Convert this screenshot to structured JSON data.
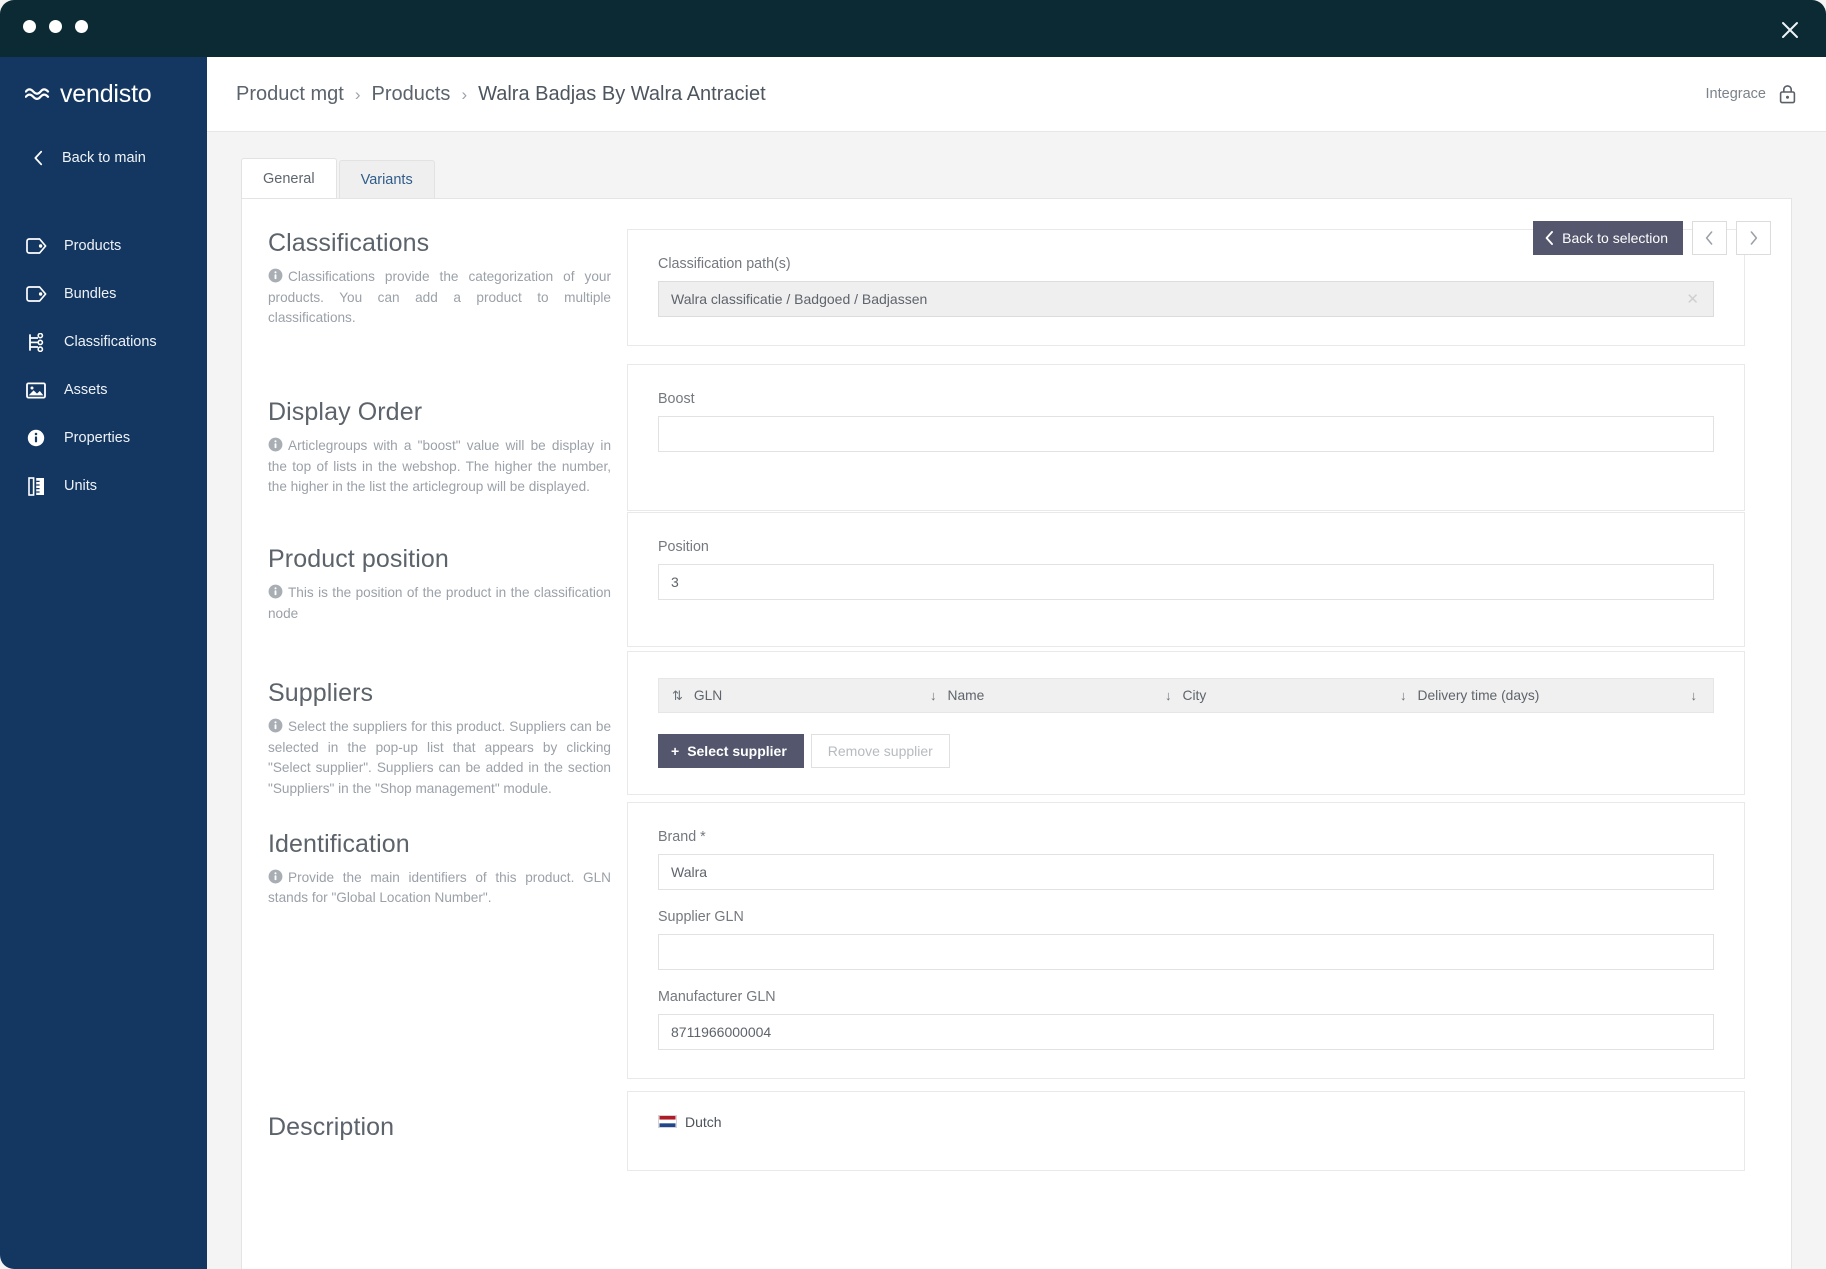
{
  "window": {
    "close_icon": "close-icon",
    "traffic_lights": 3
  },
  "sidebar": {
    "brand": "vendisto",
    "brand_icon": "waves-logo-icon",
    "back_label": "Back to main",
    "back_icon": "chevron-left-icon",
    "items": [
      {
        "label": "Products",
        "icon": "tag-icon"
      },
      {
        "label": "Bundles",
        "icon": "tag-icon"
      },
      {
        "label": "Classifications",
        "icon": "sitemap-icon"
      },
      {
        "label": "Assets",
        "icon": "image-icon"
      },
      {
        "label": "Properties",
        "icon": "info-circle-icon"
      },
      {
        "label": "Units",
        "icon": "ruler-icon"
      }
    ]
  },
  "topbar": {
    "breadcrumb": [
      "Product mgt",
      "Products",
      "Walra Badjas By Walra Antraciet"
    ],
    "separator": "›",
    "account_label": "Integrace",
    "lock_icon": "lock-icon"
  },
  "tabs": [
    {
      "label": "General",
      "active": true
    },
    {
      "label": "Variants",
      "active": false
    }
  ],
  "toolbar": {
    "back_to_selection": "Back to selection",
    "back_icon": "chevron-left-icon",
    "prev_icon": "chevron-left-icon",
    "next_icon": "chevron-right-icon"
  },
  "sections": {
    "classifications": {
      "title": "Classifications",
      "description": "Classifications provide the categorization of your products. You can add a product to multiple classifications.",
      "field_label": "Classification path(s)",
      "value": "Walra classificatie / Badgoed / Badjassen",
      "clear_icon": "close-small-icon"
    },
    "display_order": {
      "title": "Display Order",
      "description": "Articlegroups with a \"boost\" value will be display in the top of lists in the webshop. The higher the number, the higher in the list the articlegroup will be displayed.",
      "field_label": "Boost",
      "value": "",
      "placeholder": ""
    },
    "product_position": {
      "title": "Product position",
      "description": "This is the position of the product in the classification node",
      "field_label": "Position",
      "value": "3"
    },
    "suppliers": {
      "title": "Suppliers",
      "description": "Select the suppliers for this product. Suppliers can be selected in the pop-up list that appears by clicking \"Select supplier\". Suppliers can be added in the section \"Suppliers\" in the \"Shop management\" module.",
      "columns": [
        {
          "label": "GLN",
          "sort_icon": "sort-both-icon"
        },
        {
          "label": "Name",
          "sort_icon": "sort-down-icon"
        },
        {
          "label": "City",
          "sort_icon": "sort-down-icon"
        },
        {
          "label": "Delivery time (days)",
          "sort_icon": "sort-down-icon"
        }
      ],
      "rows": [],
      "select_button": "Select supplier",
      "select_button_icon": "plus-icon",
      "remove_button": "Remove supplier"
    },
    "identification": {
      "title": "Identification",
      "description": "Provide the main identifiers of this product. GLN stands for \"Global Location Number\".",
      "fields": [
        {
          "label": "Brand",
          "required": true,
          "value": "Walra"
        },
        {
          "label": "Supplier GLN",
          "required": false,
          "value": ""
        },
        {
          "label": "Manufacturer GLN",
          "required": false,
          "value": "8711966000004"
        }
      ]
    },
    "description": {
      "title": "Description",
      "language": "Dutch",
      "flag_icon": "netherlands-flag-icon"
    }
  },
  "colors": {
    "sidebar_bg": "#143761",
    "titlebar_bg": "#0b2a33",
    "button_primary": "#53566c",
    "page_bg": "#f4f4f4"
  }
}
